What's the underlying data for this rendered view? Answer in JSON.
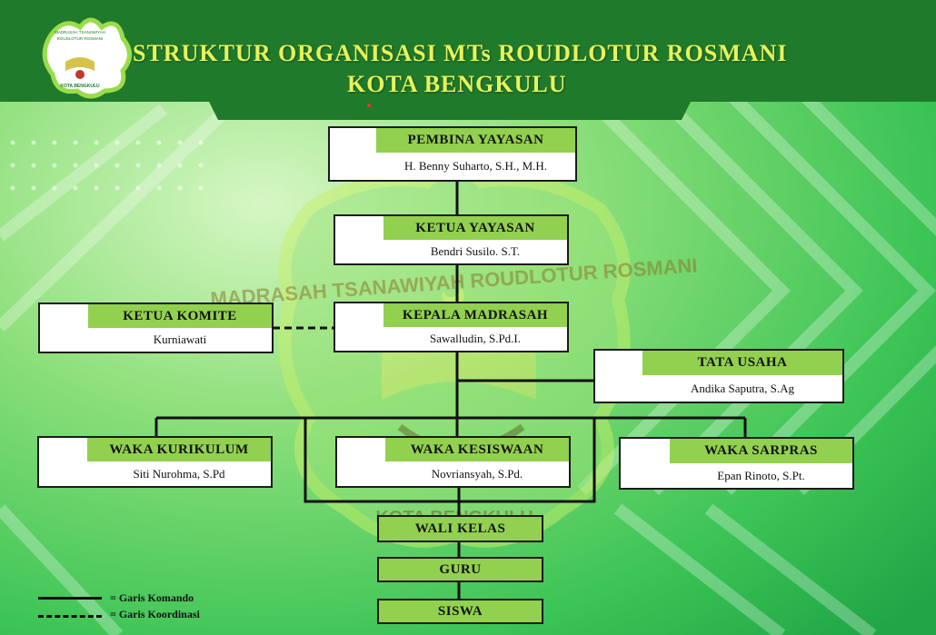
{
  "header": {
    "title_line1": "STRUKTUR ORGANISASI MTs ROUDLOTUR ROSMANI",
    "title_line2": "KOTA BENGKULU",
    "logo": {
      "top_text": "MADRASAH TSANAWIYAH",
      "mid_text": "ROUDLOTUR ROSMANI",
      "bottom_text": "KOTA BENGKULU"
    }
  },
  "watermark": {
    "arc_text": "MADRASAH TSANAWIYAH ROUDLOTUR ROSMANI",
    "bottom_text": "KOTA BENGKULU"
  },
  "nodes": {
    "pembina": {
      "role": "PEMBINA YAYASAN",
      "name": "H. Benny Suharto, S.H., M.H."
    },
    "ketua_yayasan": {
      "role": "KETUA YAYASAN",
      "name": "Bendri Susilo. S.T."
    },
    "ketua_komite": {
      "role": "KETUA KOMITE",
      "name": "Kurniawati"
    },
    "kepala": {
      "role": "KEPALA MADRASAH",
      "name": "Sawalludin, S.Pd.I."
    },
    "tata_usaha": {
      "role": "TATA USAHA",
      "name": "Andika Saputra, S.Ag"
    },
    "waka_kurikulum": {
      "role": "WAKA KURIKULUM",
      "name": "Siti Nurohma, S.Pd"
    },
    "waka_kesiswaan": {
      "role": "WAKA KESISWAAN",
      "name": "Novriansyah, S.Pd."
    },
    "waka_sarpras": {
      "role": "WAKA SARPRAS",
      "name": "Epan Rinoto, S.Pt."
    },
    "wali_kelas": {
      "role": "WALI KELAS"
    },
    "guru": {
      "role": "GURU"
    },
    "siswa": {
      "role": "SISWA"
    }
  },
  "legend": {
    "komando": "= Garis Komando",
    "koordinasi": "= Garis Koordinasi"
  },
  "colors": {
    "header_green": "#1f7a2c",
    "title_yellow": "#e8f25a",
    "role_green": "#92d050",
    "bg_light": "#a8e89a",
    "bg_dark": "#22b14c"
  }
}
